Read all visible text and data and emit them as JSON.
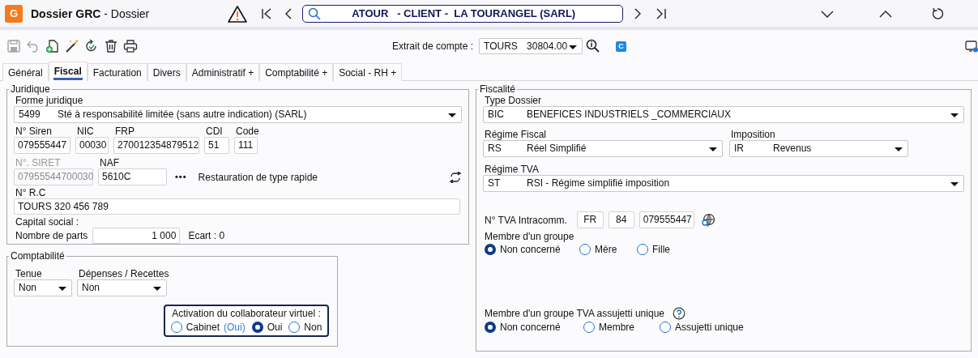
{
  "header": {
    "logo": "G",
    "title": "Dossier GRC",
    "subtitle": "- Dossier",
    "search": "ATOUR   - CLIENT -  LA TOURANGEL (SARL)"
  },
  "toolbar": {
    "tools": [
      {
        "kind": "save",
        "disabled": true
      },
      {
        "kind": "undo",
        "disabled": true
      },
      {
        "kind": "new",
        "disabled": false
      },
      {
        "kind": "wand",
        "disabled": false
      },
      {
        "kind": "refresh",
        "disabled": false
      },
      {
        "kind": "delete",
        "disabled": false
      },
      {
        "kind": "print",
        "disabled": false
      }
    ],
    "account_label": "Extrait de compte :",
    "account": {
      "code": "TOURS",
      "value": "30804.00"
    },
    "badge": "C"
  },
  "tabs": [
    {
      "label": "Général",
      "selected": false
    },
    {
      "label": "Fiscal",
      "selected": true
    },
    {
      "label": "Facturation",
      "selected": false
    },
    {
      "label": "Divers",
      "selected": false
    },
    {
      "label": "Administratif +",
      "selected": false
    },
    {
      "label": "Comptabilité +",
      "selected": false
    },
    {
      "label": "Social - RH +",
      "selected": false
    }
  ],
  "juridique": {
    "title": "Juridique",
    "forme": {
      "label": "Forme juridique",
      "code": "5499",
      "value": "Sté à responsabilité limitée (sans autre indication) (SARL)"
    },
    "ids": [
      {
        "label": "N° Siren",
        "value": "079555447"
      },
      {
        "label": "NIC",
        "value": "00030"
      },
      {
        "label": "FRP",
        "value": "270012354879512"
      },
      {
        "label": "CDI",
        "value": "51"
      },
      {
        "label": "Code",
        "value": "111"
      }
    ],
    "siret": {
      "label": "N°. SIRET",
      "value": "07955544700030",
      "disabled": true
    },
    "naf": {
      "label": "NAF",
      "value": "5610C",
      "more": "•••",
      "description": "Restauration de type rapide"
    },
    "rc": {
      "label": "N° R.C",
      "value": "TOURS 320 456 789"
    },
    "capital_label": "Capital social :",
    "parts": {
      "label": "Nombre de parts",
      "value": "1 000"
    },
    "ecart": "Ecart : 0"
  },
  "comptabilite": {
    "title": "Comptabilité",
    "selects": [
      {
        "label": "Tenue",
        "value": "Non"
      },
      {
        "label": "Dépenses / Recettes",
        "value": "Non"
      }
    ],
    "virtual": {
      "title": "Activation du collaborateur virtuel :",
      "options": [
        {
          "label": "Cabinet",
          "note": "(Oui)",
          "selected": false
        },
        {
          "label": "Oui",
          "selected": true
        },
        {
          "label": "Non",
          "selected": false
        }
      ]
    }
  },
  "fiscalite": {
    "title": "Fiscalité",
    "type_dossier": {
      "label": "Type Dossier",
      "code": "BIC",
      "value": "BENEFICES INDUSTRIELS _COMMERCIAUX"
    },
    "regime_fiscal": {
      "label": "Régime Fiscal",
      "code": "RS",
      "value": "Réel Simplifié"
    },
    "imposition": {
      "label": "Imposition",
      "code": "IR",
      "value": "Revenus"
    },
    "regime_tva": {
      "label": "Régime TVA",
      "code": "ST",
      "value": "RSI - Régime simplifié imposition"
    },
    "tva_intra": {
      "label": "N° TVA Intracomm.",
      "parts": [
        "FR",
        "84",
        "079555447"
      ]
    },
    "groupe": {
      "label": "Membre d'un groupe",
      "options": [
        {
          "label": "Non concerné",
          "selected": true
        },
        {
          "label": "Mère",
          "selected": false
        },
        {
          "label": "Fille",
          "selected": false
        }
      ]
    },
    "groupe_tva": {
      "label": "Membre d'un groupe TVA assujetti unique",
      "options": [
        {
          "label": "Non concerné",
          "selected": true
        },
        {
          "label": "Membre",
          "selected": false
        },
        {
          "label": "Assujetti unique",
          "selected": false
        }
      ]
    }
  }
}
